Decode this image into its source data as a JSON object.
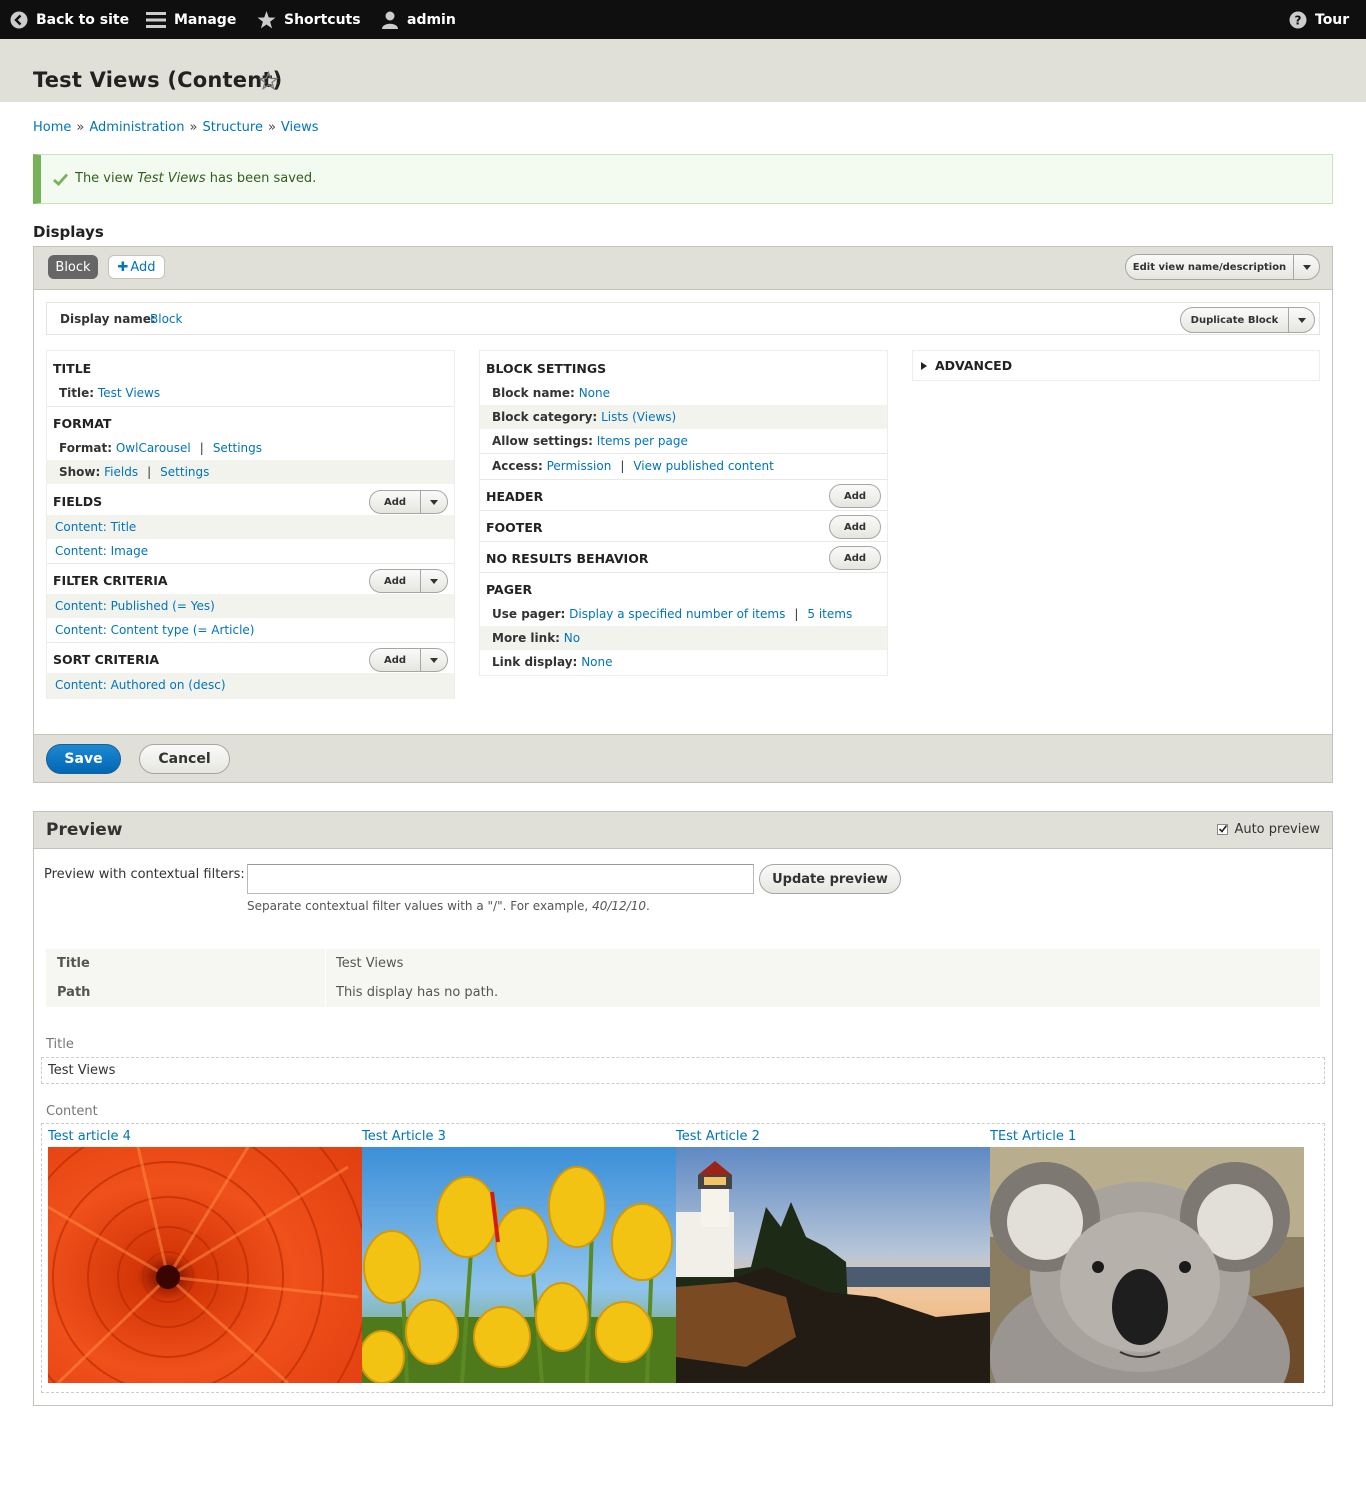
{
  "toolbar": {
    "back": "Back to site",
    "manage": "Manage",
    "shortcuts": "Shortcuts",
    "user": "admin",
    "tour": "Tour"
  },
  "page": {
    "title": "Test Views (Content)"
  },
  "breadcrumb": [
    "Home",
    "Administration",
    "Structure",
    "Views"
  ],
  "message": {
    "prefix": "The view ",
    "view_name": "Test Views",
    "suffix": " has been saved."
  },
  "displays": {
    "heading": "Displays",
    "active_tab": "Block",
    "add_tab": "Add",
    "edit_view_btn": "Edit view name/description",
    "display_name_label": "Display name:",
    "display_name_value": "Block",
    "duplicate_btn": "Duplicate Block"
  },
  "left_column": {
    "title_section": "TITLE",
    "title_label": "Title:",
    "title_value": "Test Views",
    "format_section": "FORMAT",
    "format_label": "Format:",
    "format_value": "OwlCarousel",
    "format_settings": "Settings",
    "show_label": "Show:",
    "show_value": "Fields",
    "show_settings": "Settings",
    "fields_section": "FIELDS",
    "fields": [
      "Content: Title",
      "Content: Image"
    ],
    "filter_section": "FILTER CRITERIA",
    "filters": [
      "Content: Published (= Yes)",
      "Content: Content type (= Article)"
    ],
    "sort_section": "SORT CRITERIA",
    "sorts": [
      "Content: Authored on (desc)"
    ],
    "add_label": "Add"
  },
  "middle_column": {
    "block_section": "BLOCK SETTINGS",
    "block_name_label": "Block name:",
    "block_name_value": "None",
    "block_category_label": "Block category:",
    "block_category_value": "Lists (Views)",
    "allow_settings_label": "Allow settings:",
    "allow_settings_value": "Items per page",
    "access_label": "Access:",
    "access_value": "Permission",
    "access_value2": "View published content",
    "header_section": "HEADER",
    "footer_section": "FOOTER",
    "noresults_section": "NO RESULTS BEHAVIOR",
    "pager_section": "PAGER",
    "use_pager_label": "Use pager:",
    "use_pager_value": "Display a specified number of items",
    "use_pager_value2": "5 items",
    "more_link_label": "More link:",
    "more_link_value": "No",
    "link_display_label": "Link display:",
    "link_display_value": "None",
    "add_label": "Add"
  },
  "right_column": {
    "advanced": "ADVANCED"
  },
  "actions": {
    "save": "Save",
    "cancel": "Cancel"
  },
  "preview": {
    "heading": "Preview",
    "auto_preview": "Auto preview",
    "auto_preview_checked": true,
    "contextual_label": "Preview with contextual filters:",
    "contextual_value": "",
    "update_btn": "Update preview",
    "help_prefix": "Separate contextual filter values with a \"/\". For example, ",
    "help_example": "40/12/10",
    "help_suffix": ".",
    "info": [
      {
        "key": "Title",
        "value": "Test Views"
      },
      {
        "key": "Path",
        "value": "This display has no path."
      }
    ],
    "title_label": "Title",
    "title_value": "Test Views",
    "content_label": "Content",
    "articles": [
      {
        "title": "Test article 4",
        "image": "red-chrysanthemum"
      },
      {
        "title": "Test Article 3",
        "image": "yellow-tulips"
      },
      {
        "title": "Test Article 2",
        "image": "lighthouse"
      },
      {
        "title": "TEst Article 1",
        "image": "koala"
      }
    ]
  },
  "colors": {
    "toolbar_bg": "#0f0f0f",
    "link": "#0074bd",
    "primary_button": "#0074bd",
    "status_ok": "#77b259",
    "header_bg": "#e0e0d8"
  }
}
